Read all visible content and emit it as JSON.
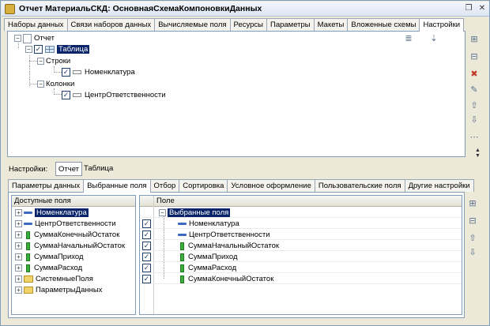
{
  "window": {
    "title": "Отчет МатериальСКД: ОсновнаяСхемаКомпоновкиДанных"
  },
  "top_tabs": [
    {
      "label": "Наборы данных",
      "active": false
    },
    {
      "label": "Связи наборов данных",
      "active": false
    },
    {
      "label": "Вычисляемые поля",
      "active": false
    },
    {
      "label": "Ресурсы",
      "active": false
    },
    {
      "label": "Параметры",
      "active": false
    },
    {
      "label": "Макеты",
      "active": false
    },
    {
      "label": "Вложенные схемы",
      "active": false
    },
    {
      "label": "Настройки",
      "active": true
    }
  ],
  "structure_tree": {
    "report": "Отчет",
    "table": "Таблица",
    "rows": "Строки",
    "rows_field": "Номенклатура",
    "columns": "Колонки",
    "columns_field": "ЦентрОтветственности"
  },
  "settings_bar": {
    "label": "Настройки:",
    "report_btn": "Отчет",
    "table_btn": "Таблица"
  },
  "settings_tabs": [
    {
      "label": "Параметры данных",
      "active": false
    },
    {
      "label": "Выбранные поля",
      "active": true
    },
    {
      "label": "Отбор",
      "active": false
    },
    {
      "label": "Сортировка",
      "active": false
    },
    {
      "label": "Условное оформление",
      "active": false
    },
    {
      "label": "Пользовательские поля",
      "active": false
    },
    {
      "label": "Другие настройки",
      "active": false
    }
  ],
  "available_fields": {
    "header": "Доступные поля",
    "items": [
      {
        "label": "Номенклатура",
        "icon": "table-field-icon",
        "selected": true
      },
      {
        "label": "ЦентрОтветственности",
        "icon": "table-field-icon"
      },
      {
        "label": "СуммаКонечныйОстаток",
        "icon": "resource-icon"
      },
      {
        "label": "СуммаНачальныйОстаток",
        "icon": "resource-icon"
      },
      {
        "label": "СуммаПриход",
        "icon": "resource-icon"
      },
      {
        "label": "СуммаРасход",
        "icon": "resource-icon"
      },
      {
        "label": "СистемныеПоля",
        "icon": "folder-icon"
      },
      {
        "label": "ПараметрыДанных",
        "icon": "folder-icon"
      }
    ]
  },
  "selected_fields": {
    "header": "Поле",
    "root": "Выбранные поля",
    "items": [
      {
        "label": "Номенклатура",
        "checked": true,
        "icon": "table-field-icon"
      },
      {
        "label": "ЦентрОтветственности",
        "checked": true,
        "icon": "table-field-icon"
      },
      {
        "label": "СуммаНачальныйОстаток",
        "checked": true,
        "icon": "resource-icon"
      },
      {
        "label": "СуммаПриход",
        "checked": true,
        "icon": "resource-icon"
      },
      {
        "label": "СуммаРасход",
        "checked": true,
        "icon": "resource-icon"
      },
      {
        "label": "СуммаКонечныйОстаток",
        "checked": true,
        "icon": "resource-icon"
      }
    ]
  },
  "colors": {
    "selection": "#0a246a",
    "panel_border": "#7f9db9",
    "window_bg": "#ece9d8"
  }
}
